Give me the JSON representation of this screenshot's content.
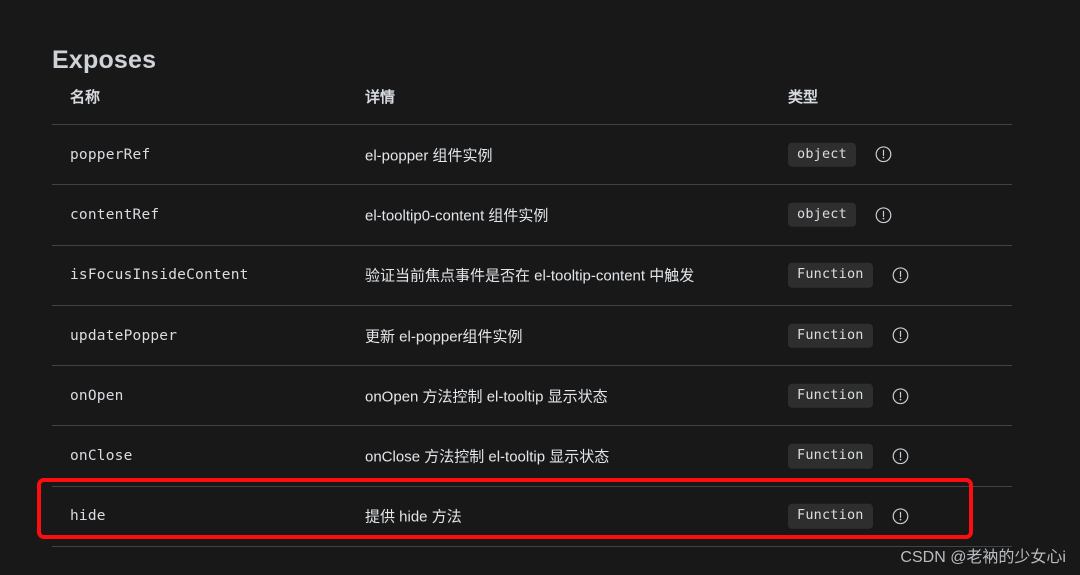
{
  "section": {
    "title": "Exposes"
  },
  "table": {
    "headers": {
      "name": "名称",
      "detail": "详情",
      "type": "类型"
    },
    "rows": [
      {
        "name": "popperRef",
        "detail": "el-popper 组件实例",
        "type": "object",
        "info_icon": "info-circle-icon"
      },
      {
        "name": "contentRef",
        "detail": "el-tooltip0-content 组件实例",
        "type": "object",
        "info_icon": "info-circle-icon"
      },
      {
        "name": "isFocusInsideContent",
        "detail": "验证当前焦点事件是否在 el-tooltip-content 中触发",
        "type": "Function",
        "info_icon": "info-circle-icon"
      },
      {
        "name": "updatePopper",
        "detail": "更新 el-popper组件实例",
        "type": "Function",
        "info_icon": "info-circle-icon"
      },
      {
        "name": "onOpen",
        "detail": "onOpen 方法控制 el-tooltip 显示状态",
        "type": "Function",
        "info_icon": "info-circle-icon"
      },
      {
        "name": "onClose",
        "detail": "onClose 方法控制 el-tooltip 显示状态",
        "type": "Function",
        "info_icon": "info-circle-icon"
      },
      {
        "name": "hide",
        "detail": "提供 hide 方法",
        "type": "Function",
        "info_icon": "info-circle-icon"
      }
    ]
  },
  "annotation": {
    "highlight_color": "#fc0d10",
    "highlighted_row_name": "hide"
  },
  "watermark": {
    "text": "CSDN @老衲的少女心i"
  },
  "colors": {
    "background": "#181818",
    "divider": "#424242",
    "badge_bg": "#2e2e2e",
    "text": "#d9dde1"
  }
}
